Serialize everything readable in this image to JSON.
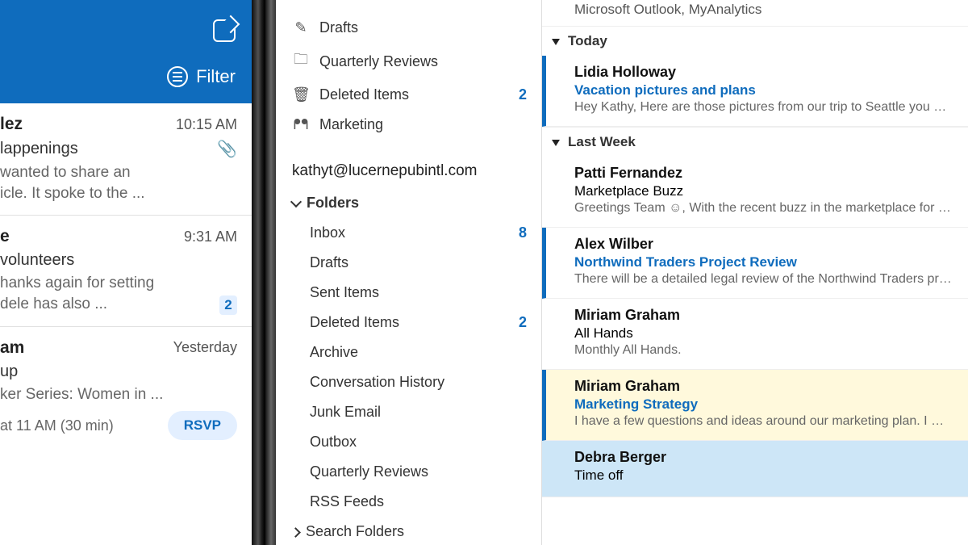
{
  "phone": {
    "filter_label": "Filter",
    "items": [
      {
        "sender": "lez",
        "time": "10:15 AM",
        "subject": "lappenings",
        "has_attachment": true,
        "preview": "wanted to share an\nicle. It spoke to the ..."
      },
      {
        "sender": "e",
        "time": "9:31 AM",
        "subject": "volunteers",
        "preview": "hanks again for setting\ndele has also ...",
        "count": "2"
      },
      {
        "sender": "am",
        "time": "Yesterday",
        "subject": "up",
        "preview": "ker Series: Women in ...",
        "rsvp_time": "at 11 AM (30 min)",
        "rsvp_label": "RSVP"
      }
    ]
  },
  "desktop": {
    "favorites": [
      {
        "icon": "✎",
        "label": "Drafts"
      },
      {
        "icon": "🗀",
        "label": "Quarterly Reviews"
      },
      {
        "icon": "🗑",
        "label": "Deleted Items",
        "count": "2"
      },
      {
        "icon": "ᖰᖳ",
        "label": "Marketing"
      }
    ],
    "account": "kathyt@lucernepubintl.com",
    "folders_label": "Folders",
    "folders": [
      {
        "label": "Inbox",
        "count": "8"
      },
      {
        "label": "Drafts"
      },
      {
        "label": "Sent Items"
      },
      {
        "label": "Deleted Items",
        "count": "2"
      },
      {
        "label": "Archive"
      },
      {
        "label": "Conversation History"
      },
      {
        "label": "Junk Email"
      },
      {
        "label": "Outbox"
      },
      {
        "label": "Quarterly Reviews"
      },
      {
        "label": "RSS Feeds"
      }
    ],
    "search_folders_label": "Search Folders"
  },
  "messages": {
    "top_line": "Microsoft Outlook, MyAnalytics",
    "groups": [
      {
        "label": "Today",
        "items": [
          {
            "sender": "Lidia Holloway",
            "subject": "Vacation pictures and plans",
            "subject_link": true,
            "preview": "Hey Kathy,  Here are those pictures from our trip to Seattle you asked for.",
            "unread": true
          }
        ]
      },
      {
        "label": "Last Week",
        "items": [
          {
            "sender": "Patti Fernandez",
            "subject": "Marketplace Buzz",
            "preview": "Greetings Team ☺,  With the recent buzz in the marketplace for the XT"
          },
          {
            "sender": "Alex Wilber",
            "subject": "Northwind Traders Project Review",
            "subject_link": true,
            "preview": "There will be a detailed legal review of the Northwind Traders project once",
            "unread": true
          },
          {
            "sender": "Miriam Graham",
            "subject": "All Hands",
            "preview": "Monthly All Hands."
          },
          {
            "sender": "Miriam Graham",
            "subject": "Marketing Strategy",
            "subject_link": true,
            "preview": "I have a few questions and ideas around our marketing plan.  I made some",
            "unread": true,
            "flagged": true
          },
          {
            "sender": "Debra Berger",
            "subject": "Time off",
            "preview": "",
            "selected": true
          }
        ]
      }
    ]
  }
}
